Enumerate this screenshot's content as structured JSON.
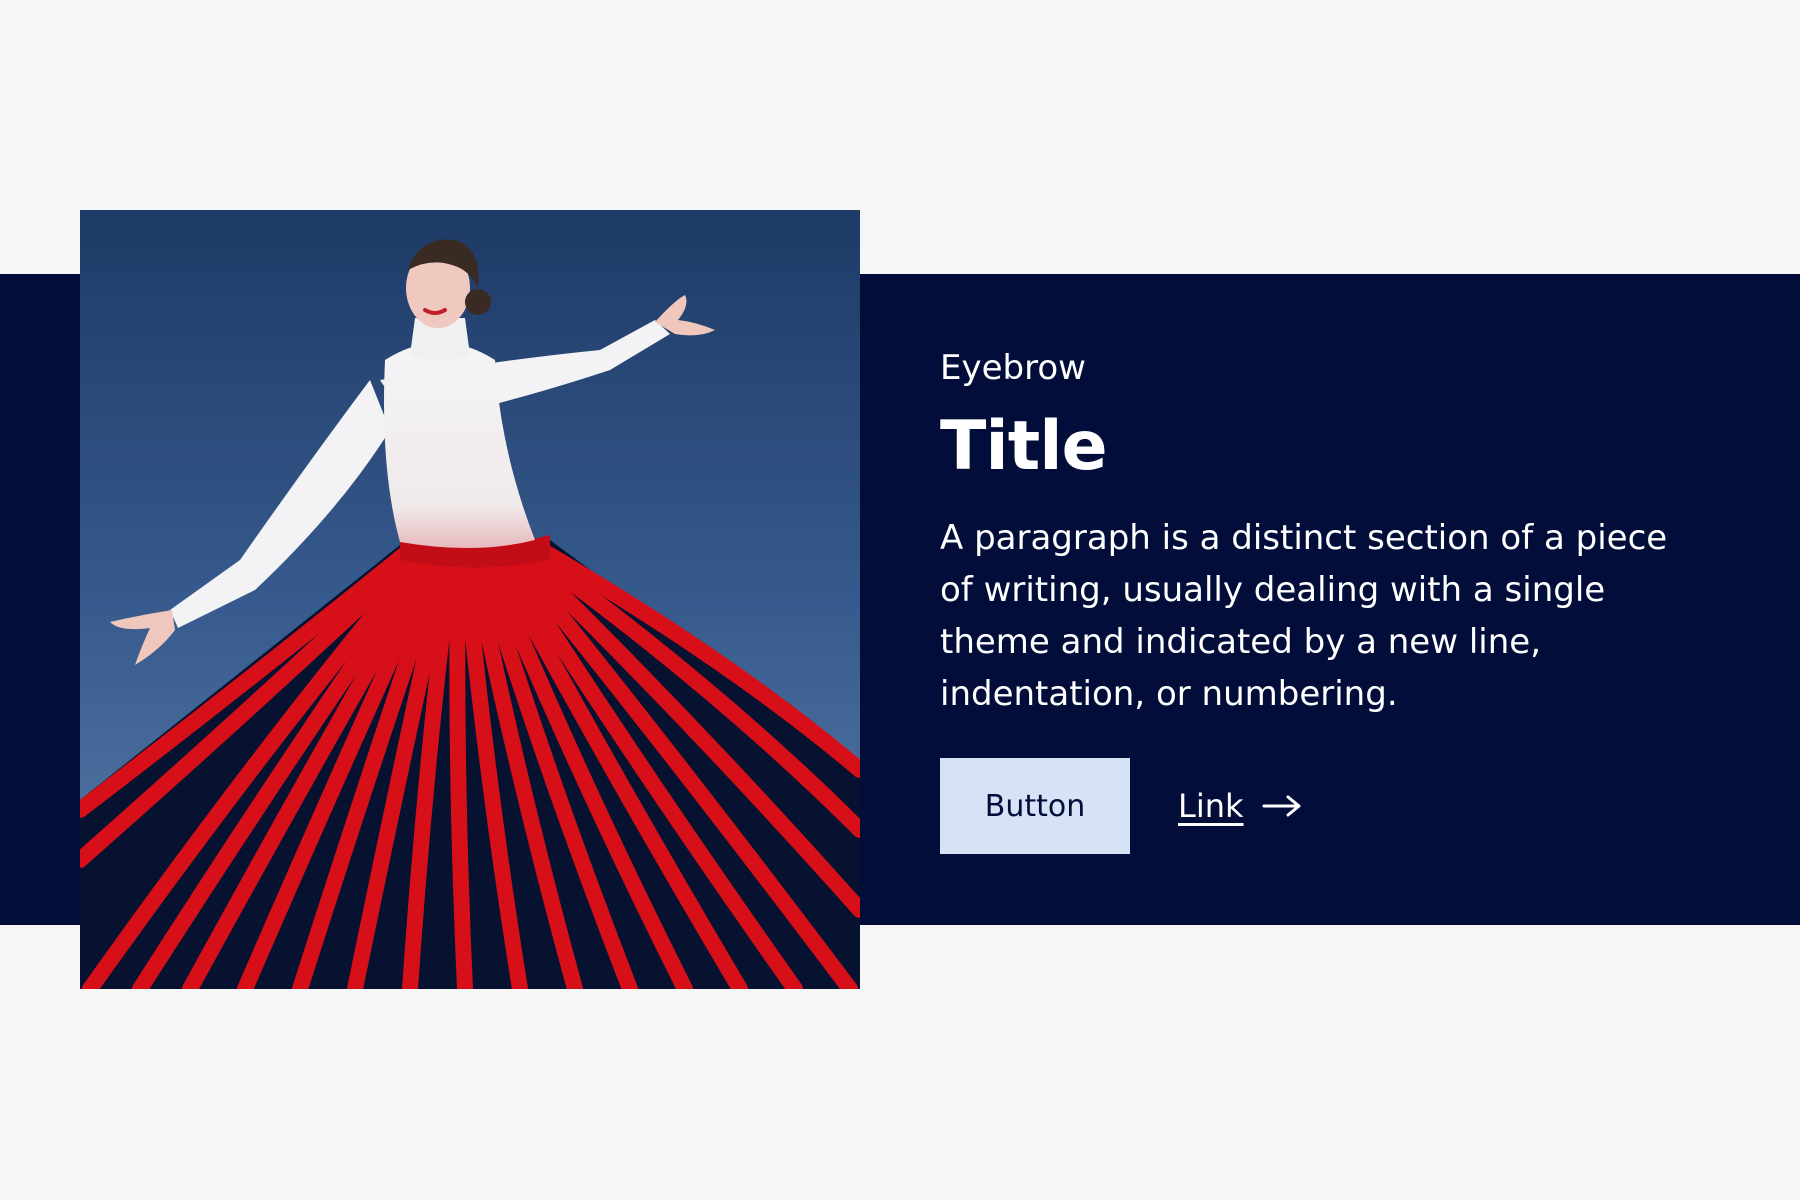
{
  "hero": {
    "eyebrow": "Eyebrow",
    "title": "Title",
    "paragraph": "A paragraph is a distinct section of a piece of writing, usually dealing with a single theme and indicated by a new line, indentation, or numbering.",
    "button_label": "Button",
    "link_label": "Link",
    "link_icon": "arrow-right-icon",
    "image_subject": "dancer-photo"
  },
  "colors": {
    "page_background": "#f6f6f6",
    "band_background": "#030d3a",
    "button_background": "#d6e2f6",
    "text_on_dark": "#ffffff",
    "skirt_red": "#d7121b"
  }
}
